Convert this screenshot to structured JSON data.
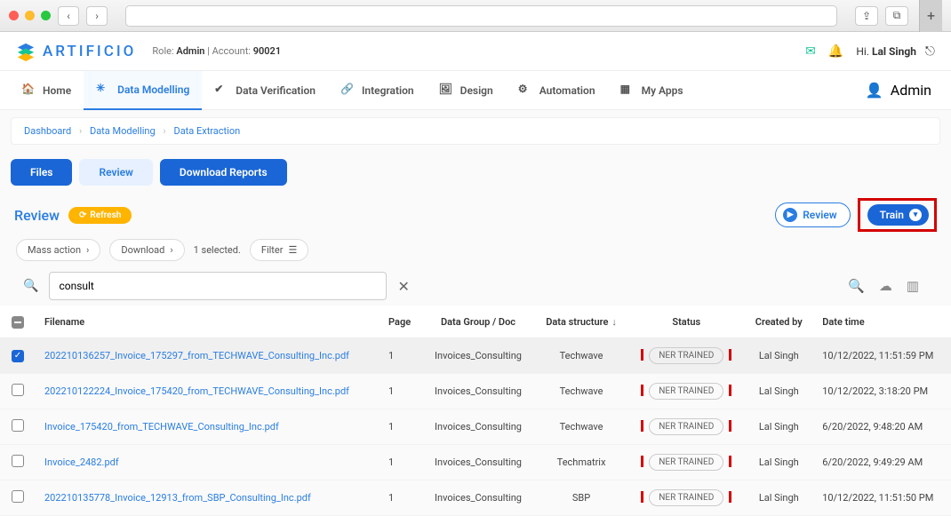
{
  "browser": {
    "plus": "+"
  },
  "brand": {
    "name": "ARTIFICIO",
    "role_prefix": "Role:",
    "role": "Admin",
    "account_prefix": "| Account:",
    "account": "90021",
    "greet_prefix": "Hi.",
    "user": "Lal Singh"
  },
  "nav": {
    "items": [
      {
        "label": "Home"
      },
      {
        "label": "Data Modelling"
      },
      {
        "label": "Data Verification"
      },
      {
        "label": "Integration"
      },
      {
        "label": "Design"
      },
      {
        "label": "Automation"
      },
      {
        "label": "My Apps"
      }
    ],
    "right": "Admin"
  },
  "breadcrumb": {
    "a": "Dashboard",
    "b": "Data Modelling",
    "c": "Data Extraction"
  },
  "subtabs": {
    "files": "Files",
    "review": "Review",
    "download": "Download Reports"
  },
  "reviewbar": {
    "title": "Review",
    "refresh": "Refresh",
    "review_btn": "Review",
    "train_btn": "Train"
  },
  "actions": {
    "mass": "Mass action",
    "download": "Download",
    "selected": "1 selected.",
    "filter": "Filter"
  },
  "search": {
    "value": "consult"
  },
  "columns": {
    "chk": "",
    "filename": "Filename",
    "page": "Page",
    "datagroup": "Data Group / Doc",
    "datastruct": "Data structure",
    "status": "Status",
    "createdby": "Created by",
    "datetime": "Date time"
  },
  "rows": [
    {
      "checked": true,
      "filename": "202210136257_Invoice_175297_from_TECHWAVE_Consulting_Inc.pdf",
      "page": "1",
      "group": "Invoices_Consulting",
      "struct": "Techwave",
      "status": "NER TRAINED",
      "by": "Lal Singh",
      "dt": "10/12/2022, 11:51:59 PM"
    },
    {
      "checked": false,
      "filename": "202210122224_Invoice_175420_from_TECHWAVE_Consulting_Inc.pdf",
      "page": "1",
      "group": "Invoices_Consulting",
      "struct": "Techwave",
      "status": "NER TRAINED",
      "by": "Lal Singh",
      "dt": "10/12/2022, 3:18:20 PM"
    },
    {
      "checked": false,
      "filename": "Invoice_175420_from_TECHWAVE_Consulting_Inc.pdf",
      "page": "1",
      "group": "Invoices_Consulting",
      "struct": "Techwave",
      "status": "NER TRAINED",
      "by": "Lal Singh",
      "dt": "6/20/2022, 9:48:20 AM"
    },
    {
      "checked": false,
      "filename": "Invoice_2482.pdf",
      "page": "1",
      "group": "Invoices_Consulting",
      "struct": "Techmatrix",
      "status": "NER TRAINED",
      "by": "Lal Singh",
      "dt": "6/20/2022, 9:49:29 AM"
    },
    {
      "checked": false,
      "filename": "202210135778_Invoice_12913_from_SBP_Consulting_Inc.pdf",
      "page": "1",
      "group": "Invoices_Consulting",
      "struct": "SBP",
      "status": "NER TRAINED",
      "by": "Lal Singh",
      "dt": "10/12/2022, 11:51:50 PM"
    }
  ]
}
